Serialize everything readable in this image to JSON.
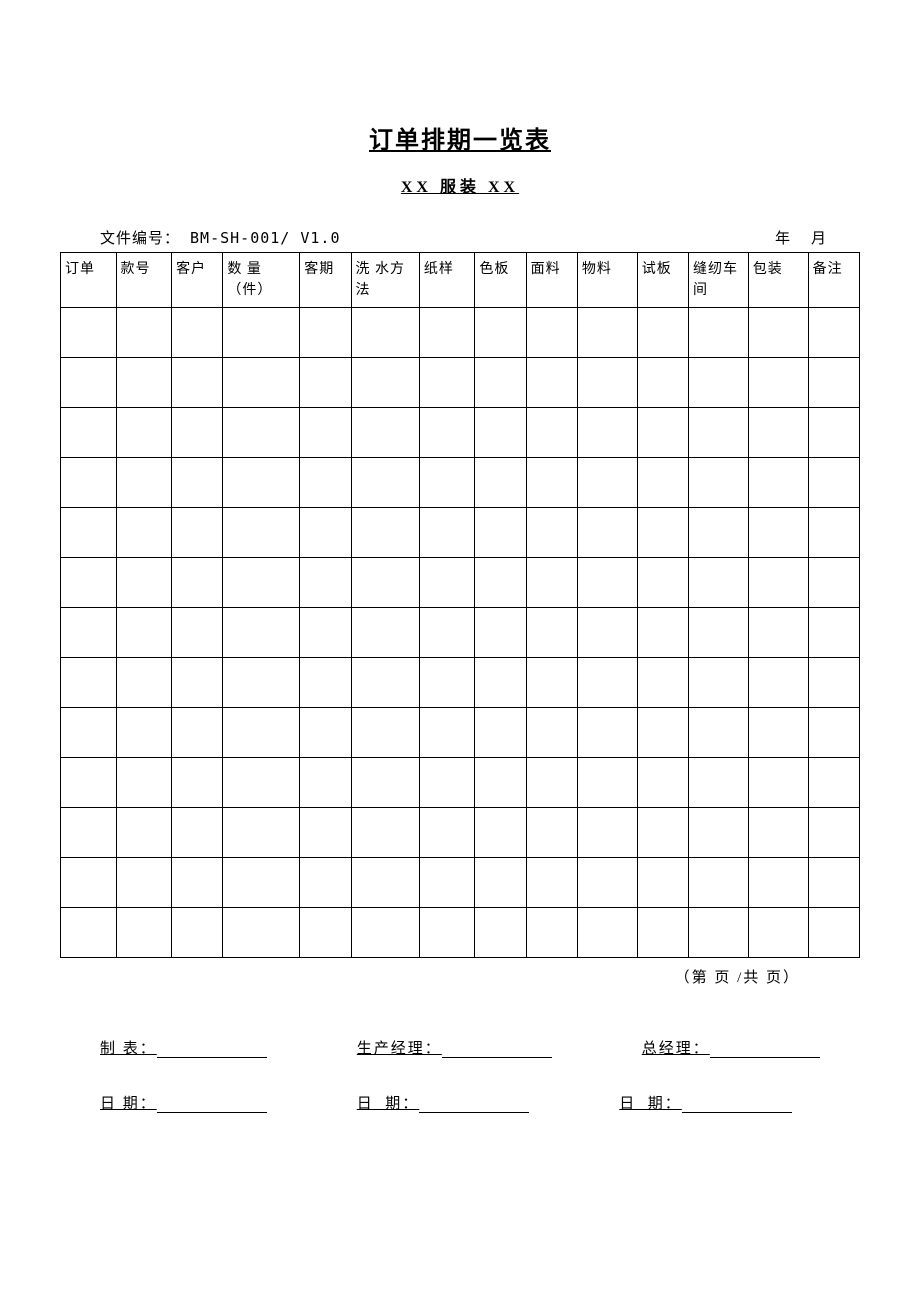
{
  "title": "订单排期一览表",
  "subtitle": "XX 服装 XX",
  "meta": {
    "doc_no_label": "文件编号： BM-SH-001/ V1.0",
    "date_label": "年   月"
  },
  "columns": [
    "订单",
    "款号",
    "客户",
    "数  量（件）",
    "客期",
    "洗 水方法",
    "纸样",
    "色板",
    "面料",
    "物料",
    "试板",
    "缝纫车间",
    "包装",
    "备注"
  ],
  "rows": [
    [
      "",
      "",
      "",
      "",
      "",
      "",
      "",
      "",
      "",
      "",
      "",
      "",
      "",
      ""
    ],
    [
      "",
      "",
      "",
      "",
      "",
      "",
      "",
      "",
      "",
      "",
      "",
      "",
      "",
      ""
    ],
    [
      "",
      "",
      "",
      "",
      "",
      "",
      "",
      "",
      "",
      "",
      "",
      "",
      "",
      ""
    ],
    [
      "",
      "",
      "",
      "",
      "",
      "",
      "",
      "",
      "",
      "",
      "",
      "",
      "",
      ""
    ],
    [
      "",
      "",
      "",
      "",
      "",
      "",
      "",
      "",
      "",
      "",
      "",
      "",
      "",
      ""
    ],
    [
      "",
      "",
      "",
      "",
      "",
      "",
      "",
      "",
      "",
      "",
      "",
      "",
      "",
      ""
    ],
    [
      "",
      "",
      "",
      "",
      "",
      "",
      "",
      "",
      "",
      "",
      "",
      "",
      "",
      ""
    ],
    [
      "",
      "",
      "",
      "",
      "",
      "",
      "",
      "",
      "",
      "",
      "",
      "",
      "",
      ""
    ],
    [
      "",
      "",
      "",
      "",
      "",
      "",
      "",
      "",
      "",
      "",
      "",
      "",
      "",
      ""
    ],
    [
      "",
      "",
      "",
      "",
      "",
      "",
      "",
      "",
      "",
      "",
      "",
      "",
      "",
      ""
    ],
    [
      "",
      "",
      "",
      "",
      "",
      "",
      "",
      "",
      "",
      "",
      "",
      "",
      "",
      ""
    ],
    [
      "",
      "",
      "",
      "",
      "",
      "",
      "",
      "",
      "",
      "",
      "",
      "",
      "",
      ""
    ],
    [
      "",
      "",
      "",
      "",
      "",
      "",
      "",
      "",
      "",
      "",
      "",
      "",
      "",
      ""
    ]
  ],
  "pager": "（第  页 /共  页）",
  "signatures": {
    "row1": [
      "制 表：",
      "生产经理：",
      "总经理："
    ],
    "row2": [
      "日 期：",
      "日  期：",
      "日  期："
    ]
  }
}
